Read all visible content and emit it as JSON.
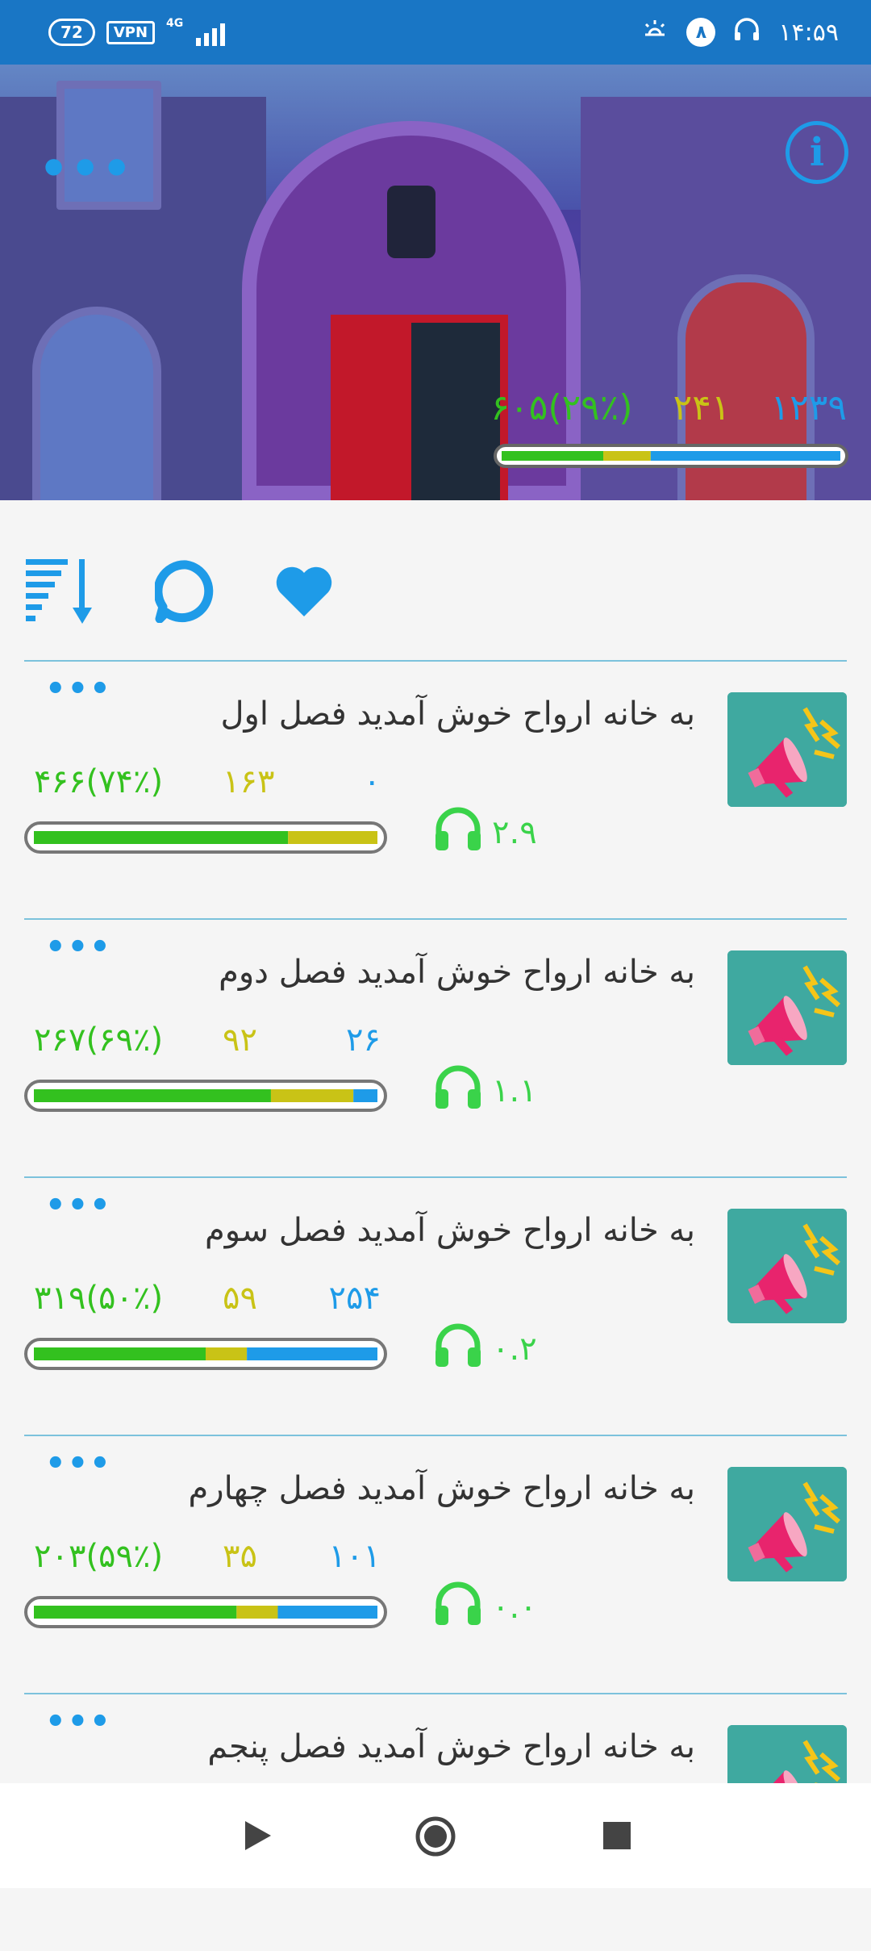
{
  "status_bar": {
    "battery": "72",
    "vpn": "VPN",
    "network": "4G",
    "notification_count": "۸",
    "time": "۱۴:۵۹"
  },
  "hero": {
    "stats": {
      "green": "۶۰۵(۲۹٪)",
      "yellow": "۲۴۱",
      "blue": "۱۲۳۹"
    },
    "progress": {
      "green": 0.3,
      "yellow": 0.14,
      "blue": 0.56
    }
  },
  "toolbar": {
    "icons": [
      "sort-icon",
      "comment-icon",
      "heart-icon"
    ]
  },
  "episodes": [
    {
      "title": "به خانه ارواح خوش آمدید فصل اول",
      "green": "۴۶۶(۷۴٪)",
      "yellow": "۱۶۳",
      "blue": "۰",
      "listen": "۲.۹",
      "progress": {
        "green": 0.74,
        "yellow": 0.26,
        "blue": 0.0
      }
    },
    {
      "title": "به خانه ارواح خوش آمدید فصل دوم",
      "green": "۲۶۷(۶۹٪)",
      "yellow": "۹۲",
      "blue": "۲۶",
      "listen": "۱.۱",
      "progress": {
        "green": 0.69,
        "yellow": 0.24,
        "blue": 0.07
      }
    },
    {
      "title": "به خانه ارواح خوش آمدید فصل سوم",
      "green": "۳۱۹(۵۰٪)",
      "yellow": "۵۹",
      "blue": "۲۵۴",
      "listen": "۰.۲",
      "progress": {
        "green": 0.5,
        "yellow": 0.12,
        "blue": 0.38
      }
    },
    {
      "title": "به خانه ارواح خوش آمدید فصل چهارم",
      "green": "۲۰۳(۵۹٪)",
      "yellow": "۳۵",
      "blue": "۱۰۱",
      "listen": "۰.۰",
      "progress": {
        "green": 0.59,
        "yellow": 0.12,
        "blue": 0.29
      }
    },
    {
      "title": "به خانه ارواح خوش آمدید فصل پنجم"
    }
  ],
  "nav": {
    "icons": [
      "back-triangle-icon",
      "home-circle-icon",
      "recents-square-icon"
    ]
  },
  "colors": {
    "green": "#33c11f",
    "yellow": "#c9c316",
    "blue": "#1e9be8",
    "accent": "#1976c5"
  }
}
